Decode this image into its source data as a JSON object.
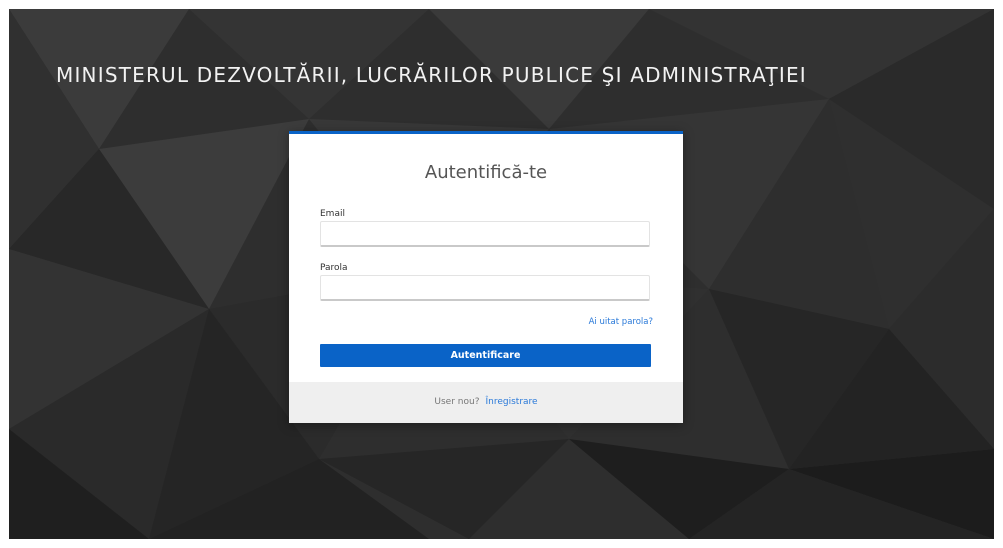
{
  "header": {
    "title": "MINISTERUL DEZVOLTĂRII, LUCRĂRILOR PUBLICE ŞI ADMINISTRAŢIEI"
  },
  "login": {
    "title": "Autentifică-te",
    "email_label": "Email",
    "email_value": "",
    "password_label": "Parola",
    "password_value": "",
    "forgot_password": "Ai uitat parola?",
    "submit_label": "Autentificare",
    "footer_text": "User nou?",
    "register_link": "Înregistrare"
  },
  "colors": {
    "accent": "#0a63c7",
    "link": "#2b7ad9",
    "background": "#2f2f2f",
    "footer_bg": "#efefef"
  }
}
